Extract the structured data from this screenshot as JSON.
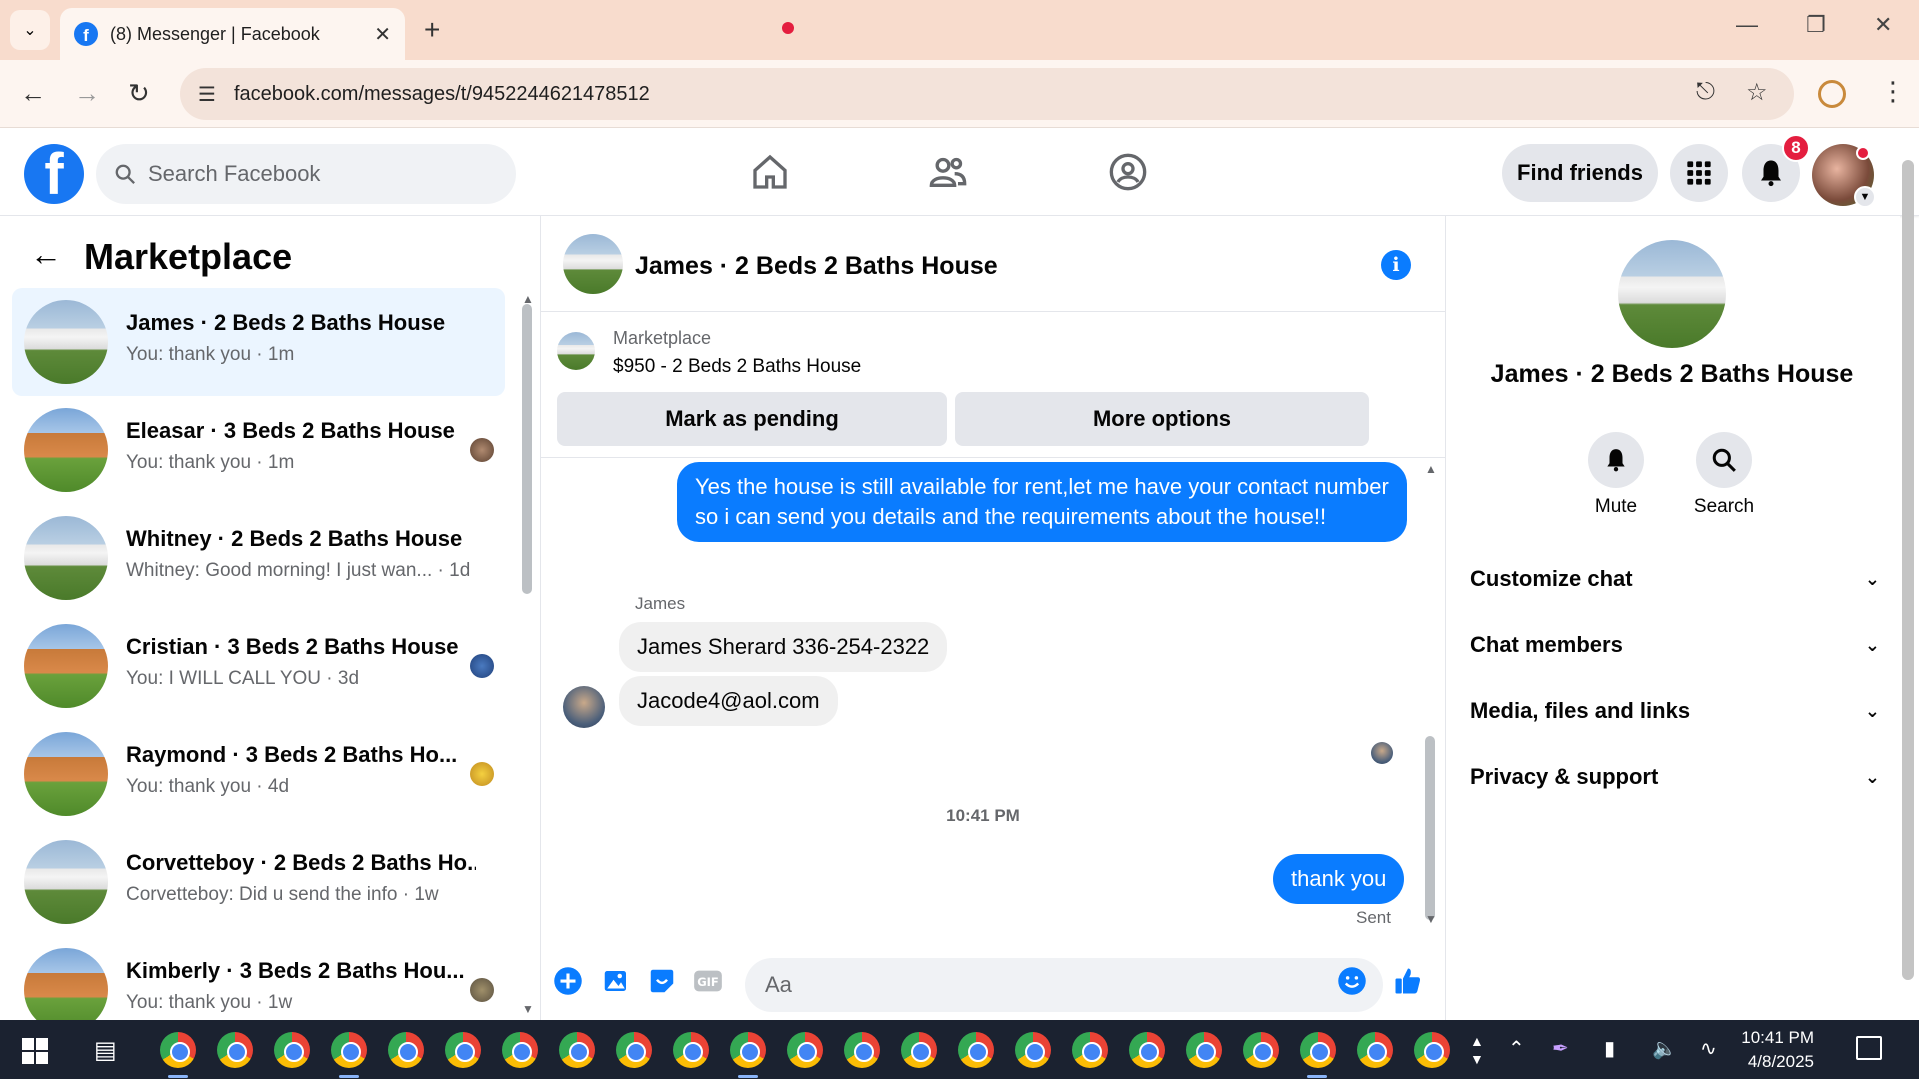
{
  "browser": {
    "tab_title": "(8) Messenger | Facebook",
    "url": "facebook.com/messages/t/9452244621478512"
  },
  "fb_header": {
    "search_placeholder": "Search Facebook",
    "find_friends_label": "Find friends",
    "notification_count": "8"
  },
  "left_pane": {
    "title": "Marketplace",
    "conversations": [
      {
        "name": "James · 2 Beds 2 Baths House",
        "preview": "You: thank you · 1m",
        "house": "white",
        "active": true
      },
      {
        "name": "Eleasar · 3 Beds 2 Baths House",
        "preview": "You: thank you · 1m",
        "house": "brown",
        "active": false
      },
      {
        "name": "Whitney · 2 Beds 2 Baths House",
        "preview": "Whitney: Good morning! I just wan... · 1d",
        "house": "white",
        "active": false
      },
      {
        "name": "Cristian · 3 Beds 2 Baths House",
        "preview": "You: I WILL CALL YOU · 3d",
        "house": "brown",
        "active": false
      },
      {
        "name": "Raymond · 3 Beds 2 Baths Ho...",
        "preview": "You: thank you · 4d",
        "house": "brown",
        "active": false
      },
      {
        "name": "Corvetteboy · 2 Beds 2 Baths Ho...",
        "preview": "Corvetteboy: Did u send the info · 1w",
        "house": "white",
        "active": false
      },
      {
        "name": "Kimberly · 3 Beds 2 Baths Hou...",
        "preview": "You: thank you · 1w",
        "house": "brown",
        "active": false
      }
    ]
  },
  "chat": {
    "title": "James · 2 Beds 2 Baths House",
    "listing_label": "Marketplace",
    "listing_price": "$950 - 2 Beds 2 Baths House",
    "mark_pending_label": "Mark as pending",
    "more_options_label": "More options",
    "messages": {
      "outgoing_1": "Yes the house is still available for rent,let me have your contact number so i can send you details and the requirements about the house!!",
      "sender_name": "James",
      "incoming_1": "James Sherard 336-254-2322",
      "incoming_2": "Jacode4@aol.com",
      "timestamp": "10:41 PM",
      "outgoing_2": "thank you",
      "status": "Sent"
    },
    "input_placeholder": "Aa"
  },
  "right_pane": {
    "name": "James · 2 Beds 2 Baths House",
    "mute_label": "Mute",
    "search_label": "Search",
    "sections": [
      "Customize chat",
      "Chat members",
      "Media, files and links",
      "Privacy & support"
    ]
  },
  "taskbar": {
    "time": "10:41 PM",
    "date": "4/8/2025"
  },
  "colors": {
    "fb_blue": "#1877f2",
    "messenger_blue": "#0a7cff",
    "notification_red": "#e41e3f",
    "active_row": "#ebf5ff"
  }
}
